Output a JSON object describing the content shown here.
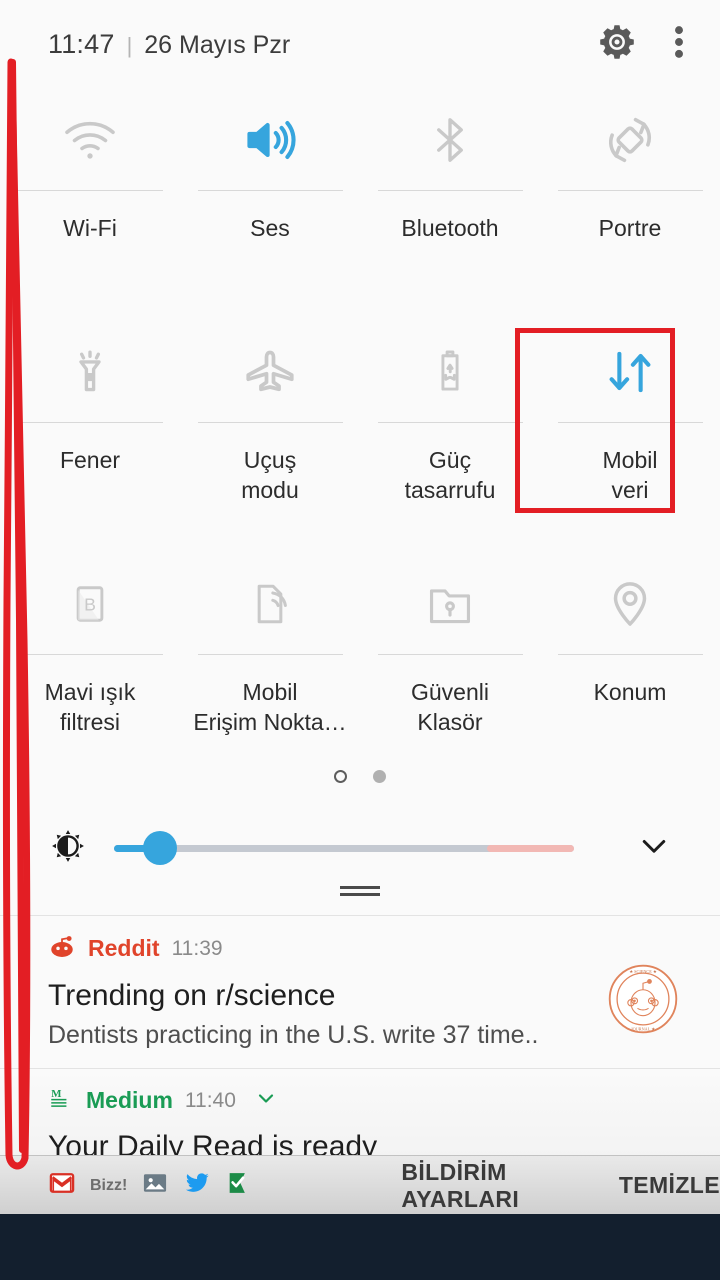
{
  "header": {
    "clock": "11:47",
    "separator": "|",
    "date": "26 Mayıs Pzr",
    "settings_icon": "gear-icon",
    "overflow_icon": "more-vertical-icon"
  },
  "accent": {
    "active_blue": "#36a5dd",
    "inactive_gray": "#c9c9c9",
    "annotation_red": "#e31e24",
    "panel_bg": "#fafafa",
    "nav_bg": "#131f2e"
  },
  "quick_settings": {
    "rows": [
      [
        {
          "label": "Wi-Fi",
          "icon": "wifi-icon",
          "active": false
        },
        {
          "label": "Ses",
          "icon": "sound-icon",
          "active": true
        },
        {
          "label": "Bluetooth",
          "icon": "bluetooth-icon",
          "active": false
        },
        {
          "label": "Portre",
          "icon": "rotation-lock-icon",
          "active": false
        }
      ],
      [
        {
          "label": "Fener",
          "icon": "flashlight-icon",
          "active": false
        },
        {
          "label": "Uçuş\nmodu",
          "icon": "airplane-icon",
          "active": false
        },
        {
          "label": "Güç\ntasarrufu",
          "icon": "power-saving-icon",
          "active": false
        },
        {
          "label": "Mobil\nveri",
          "icon": "mobile-data-icon",
          "active": true,
          "highlighted": true
        }
      ],
      [
        {
          "label": "Mavi ışık\nfiltresi",
          "icon": "blue-light-filter-icon",
          "active": false
        },
        {
          "label": "Mobil\nErişim Nokta…",
          "icon": "hotspot-icon",
          "active": false
        },
        {
          "label": "Güvenli\nKlasör",
          "icon": "secure-folder-icon",
          "active": false
        },
        {
          "label": "Konum",
          "icon": "location-pin-icon",
          "active": false
        }
      ]
    ]
  },
  "page_indicator": {
    "total": 2,
    "active_index": 0
  },
  "brightness": {
    "icon": "brightness-icon",
    "value_percent": 10,
    "warm_start_percent": 81,
    "expand_icon": "chevron-down-icon"
  },
  "drag_handle": "panel-drag-handle",
  "notifications": [
    {
      "app": "Reddit",
      "app_color": "#e0442b",
      "time": "11:39",
      "title": "Trending on r/science",
      "body": "Dentists practicing in the U.S. write 37 time..",
      "thumbnail": "reddit-snoo-seal-icon",
      "expandable": false
    },
    {
      "app": "Medium",
      "app_color": "#1a9c55",
      "time": "11:40",
      "title": "Your Daily Read is ready",
      "body": "",
      "thumbnail": "",
      "expandable": true,
      "expand_icon": "chevron-down-icon"
    }
  ],
  "bottom_bar": {
    "tray_icons": [
      {
        "name": "gmail-icon"
      },
      {
        "name": "bizz-label",
        "text": "Bizz!"
      },
      {
        "name": "gallery-icon"
      },
      {
        "name": "twitter-icon"
      },
      {
        "name": "check-flag-icon"
      }
    ],
    "notification_settings_label": "BİLDİRİM AYARLARI",
    "clear_label": "TEMİZLE"
  },
  "annotation": {
    "loop": "red-vertical-loop-annotation",
    "box": "red-box-around-mobile-data"
  }
}
